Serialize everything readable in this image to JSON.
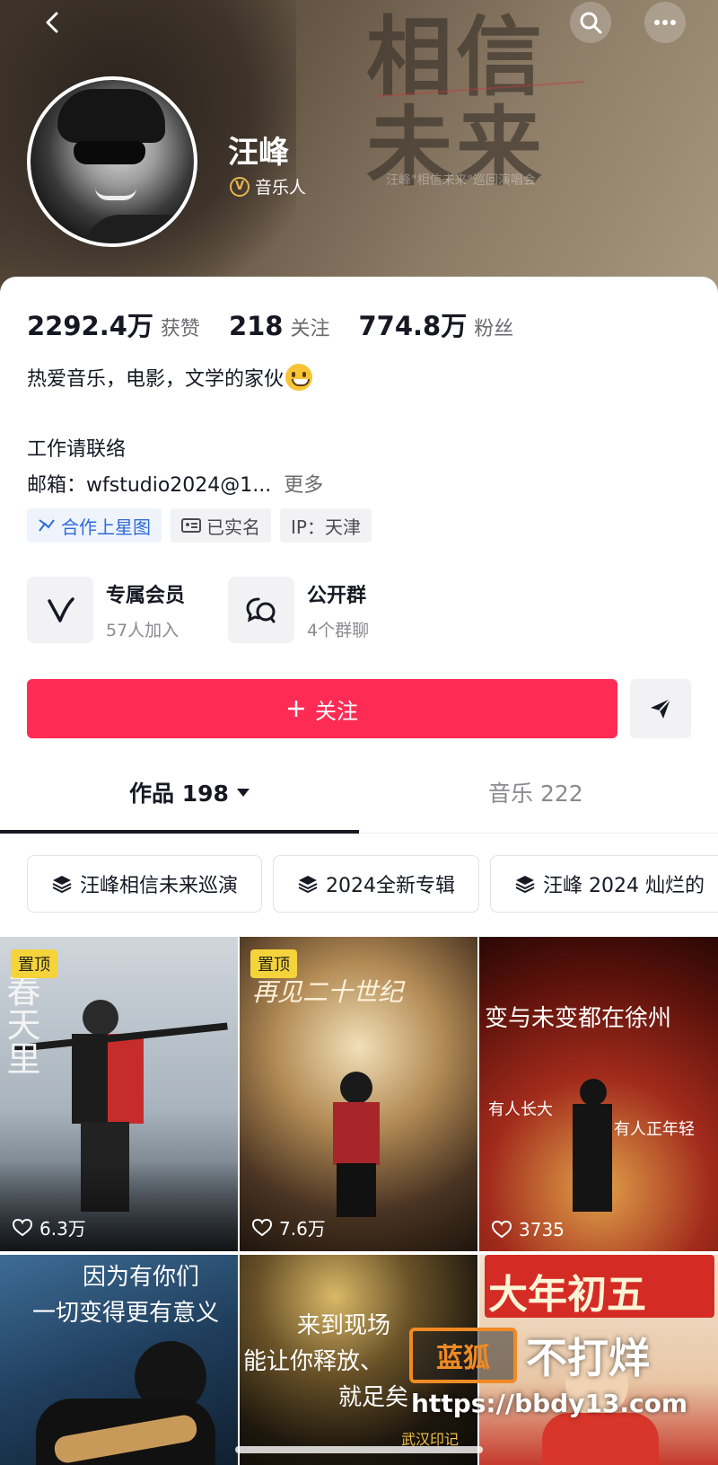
{
  "header": {
    "name": "汪峰",
    "verify_label": "音乐人",
    "verify_badge": "V",
    "poster_line1": "相信",
    "poster_line2": "未来",
    "poster_small": "汪峰\"相信未来\"巡回演唱会"
  },
  "stats": [
    {
      "value": "2292.4万",
      "label": "获赞"
    },
    {
      "value": "218",
      "label": "关注"
    },
    {
      "value": "774.8万",
      "label": "粉丝"
    }
  ],
  "bio": {
    "line1": "热爱音乐，电影，文学的家伙",
    "line2": "工作请联络",
    "line3": "邮箱：wfstudio2024@1...",
    "more": "更多"
  },
  "tags": [
    {
      "label": "合作上星图",
      "icon": "star-map-icon"
    },
    {
      "label": "已实名",
      "icon": "id-card-icon"
    },
    {
      "label": "IP：天津",
      "icon": ""
    }
  ],
  "clubs": [
    {
      "title": "专属会员",
      "subtitle": "57人加入",
      "icon": "v-member-icon"
    },
    {
      "title": "公开群",
      "subtitle": "4个群聊",
      "icon": "group-chat-icon"
    }
  ],
  "actions": {
    "follow_label": "关注",
    "follow_icon": "plus-icon",
    "share_icon": "send-icon"
  },
  "tabs": {
    "works_label": "作品 198",
    "music_label": "音乐 222"
  },
  "chips": [
    {
      "label": "汪峰相信未来巡演"
    },
    {
      "label": "2024全新专辑"
    },
    {
      "label": "汪峰 2024 灿烂的"
    }
  ],
  "videos": [
    {
      "pinned": "置顶",
      "likes": "6.3万",
      "caption": "春天里"
    },
    {
      "pinned": "置顶",
      "likes": "7.6万",
      "caption": "再见二十世纪"
    },
    {
      "pinned": "",
      "likes": "3735",
      "caption": "变与未变都在徐州",
      "caption2": "有人长大",
      "caption3": "有人正年轻"
    },
    {
      "pinned": "",
      "likes": "",
      "caption": "因为有你们",
      "caption2": "一切变得更有意义"
    },
    {
      "pinned": "",
      "likes": "",
      "caption": "来到现场",
      "caption2": "能让你释放、",
      "caption3": "就足矣",
      "caption4": "武汉印记"
    },
    {
      "pinned": "",
      "likes": "",
      "caption": "大年初五"
    }
  ],
  "watermark": {
    "box": "蓝狐",
    "text": "不打烊",
    "url": "https://bbdy13.com"
  },
  "colors": {
    "accent": "#fe2c55",
    "pin": "#f5d33b",
    "verify": "#e8b64a",
    "link_blue": "#2f6bd6"
  }
}
